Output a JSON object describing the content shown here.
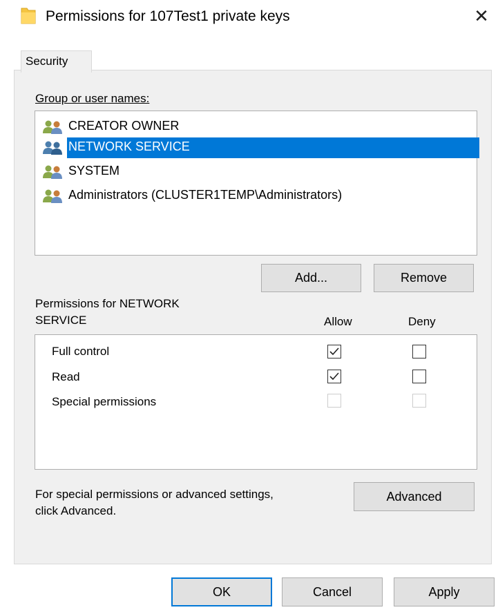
{
  "window": {
    "title": "Permissions for 107Test1 private keys",
    "close_glyph": "✕"
  },
  "tabs": [
    {
      "label": "Security",
      "selected": true
    }
  ],
  "group_section": {
    "label": "Group or user names:",
    "users": [
      {
        "name": "CREATOR OWNER",
        "icon": "users-group-icon",
        "selected": false
      },
      {
        "name": "NETWORK SERVICE",
        "icon": "users-group-icon",
        "selected": true
      },
      {
        "name": "SYSTEM",
        "icon": "users-group-icon",
        "selected": false
      },
      {
        "name": "Administrators (CLUSTER1TEMP\\Administrators)",
        "icon": "users-group-icon",
        "selected": false
      }
    ],
    "add_label": "Add...",
    "remove_label": "Remove"
  },
  "permissions_section": {
    "label_line1": "Permissions for NETWORK",
    "label_line2": "SERVICE",
    "allow_header": "Allow",
    "deny_header": "Deny",
    "rows": [
      {
        "name": "Full control",
        "allow": true,
        "deny": false,
        "enabled": true
      },
      {
        "name": "Read",
        "allow": true,
        "deny": false,
        "enabled": true
      },
      {
        "name": "Special permissions",
        "allow": false,
        "deny": false,
        "enabled": false
      }
    ]
  },
  "advanced_section": {
    "text_line1": "For special permissions or advanced settings,",
    "text_line2": "click Advanced.",
    "button_label": "Advanced"
  },
  "footer": {
    "ok_label": "OK",
    "cancel_label": "Cancel",
    "apply_label": "Apply"
  },
  "colors": {
    "selection": "#0078d7",
    "dialog_bg": "#f0f0f0",
    "folder_icon": "#f5c542"
  }
}
